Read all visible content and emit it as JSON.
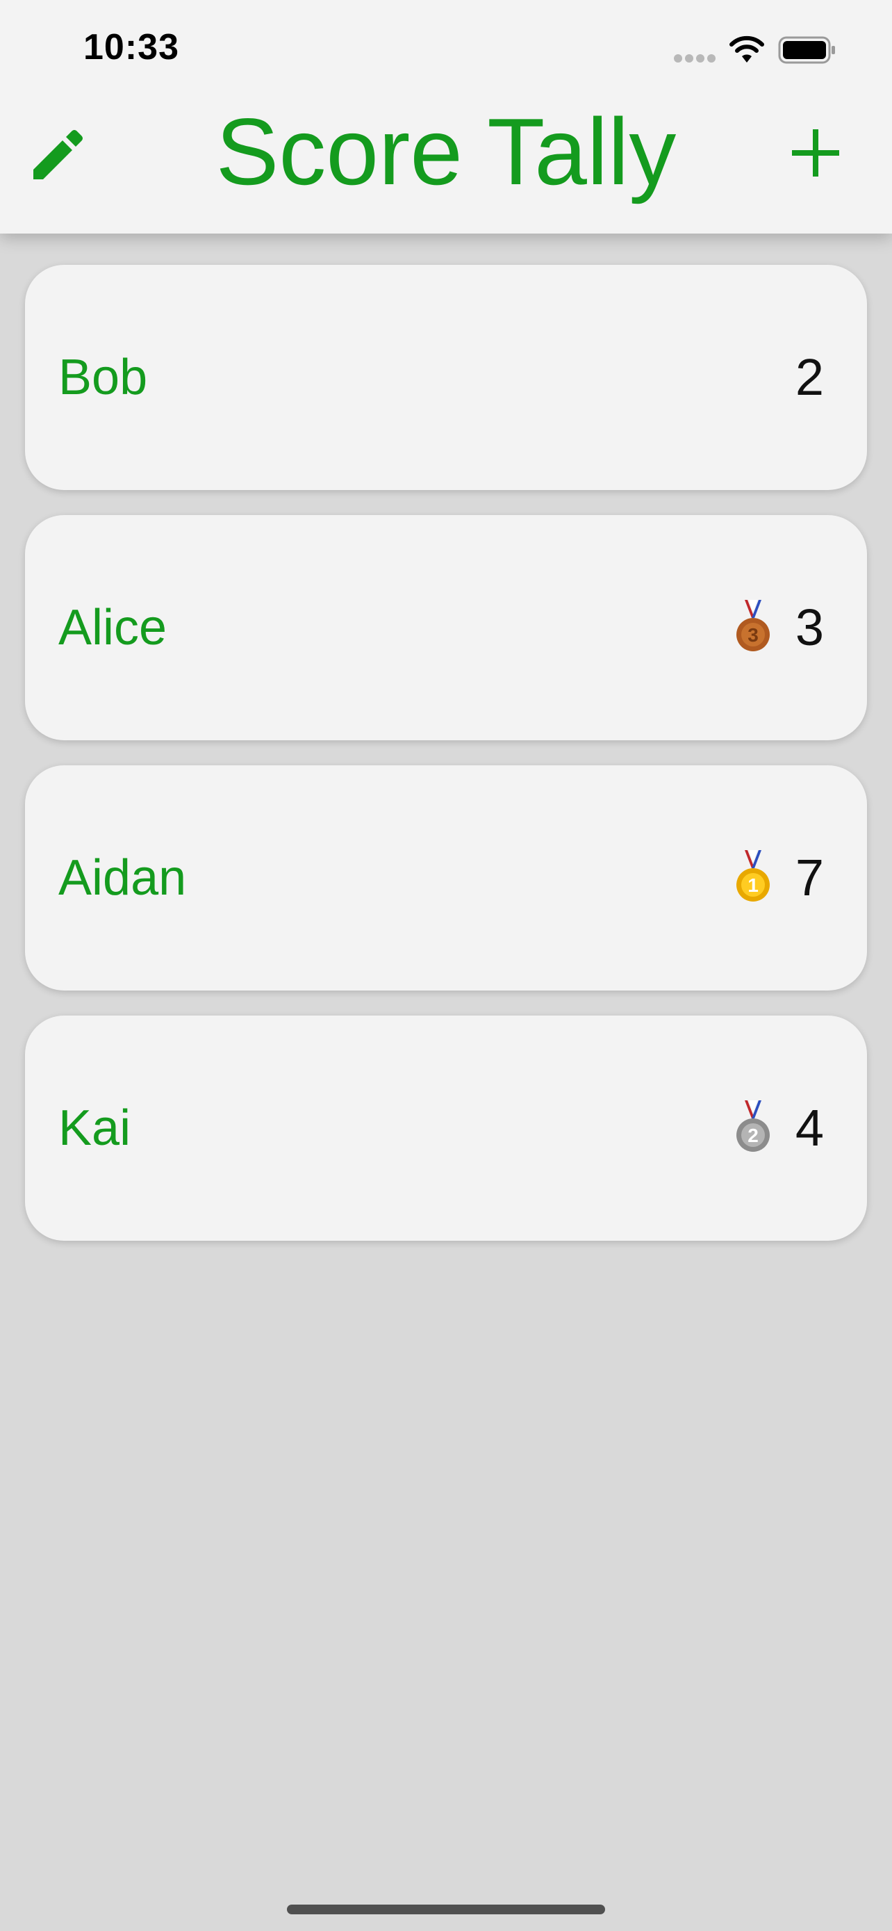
{
  "status_bar": {
    "time": "10:33",
    "signal_icon": "cellular-signal-icon",
    "wifi_icon": "wifi-icon",
    "battery_icon": "battery-icon"
  },
  "header": {
    "title": "Score Tally",
    "left_action_icon": "pencil-icon",
    "right_action_icon": "plus-icon",
    "accent_color": "#149b1e"
  },
  "players": [
    {
      "name": "Bob",
      "score": "2",
      "medal": null
    },
    {
      "name": "Alice",
      "score": "3",
      "medal": "bronze-medal-icon"
    },
    {
      "name": "Aidan",
      "score": "7",
      "medal": "gold-medal-icon"
    },
    {
      "name": "Kai",
      "score": "4",
      "medal": "silver-medal-icon"
    }
  ],
  "colors": {
    "background": "#d9d9d9",
    "card": "#f3f3f3",
    "name_text": "#149b1e",
    "score_text": "#111111"
  }
}
